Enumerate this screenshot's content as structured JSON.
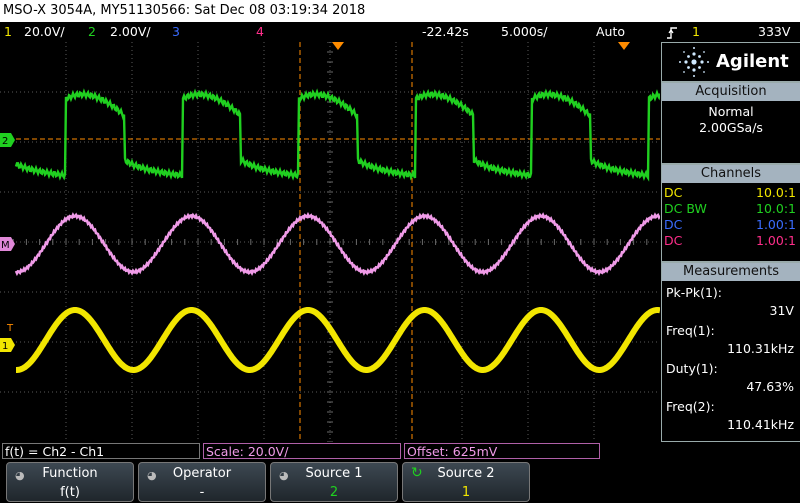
{
  "titlebar": {
    "text": "MSO-X 3054A, MY51130566: Sat Dec 08 03:19:34 2018"
  },
  "channels_bar": {
    "ch1_num": "1",
    "ch1_scale": "20.0V/",
    "ch2_num": "2",
    "ch2_scale": "2.00V/",
    "ch3_num": "3",
    "ch4_num": "4",
    "time_offset": "-22.42s",
    "time_scale": "5.000s/",
    "trigger_mode": "Auto",
    "trigger_icon": "trigger-edge-icon",
    "trigger_source": "1",
    "trigger_level": "333V"
  },
  "logo": {
    "brand": "Agilent",
    "icon": "agilent-spark-icon"
  },
  "acquisition": {
    "title": "Acquisition",
    "mode": "Normal",
    "rate": "2.00GSa/s"
  },
  "channels": {
    "title": "Channels",
    "rows": [
      {
        "coupling": "DC",
        "probe": "10.0:1",
        "color": "#f2e600"
      },
      {
        "coupling": "DC BW",
        "probe": "10.0:1",
        "color": "#20d020"
      },
      {
        "coupling": "DC",
        "probe": "1.00:1",
        "color": "#3a6cff"
      },
      {
        "coupling": "DC",
        "probe": "1.00:1",
        "color": "#ff2e8a"
      }
    ]
  },
  "measurements": {
    "title": "Measurements",
    "items": [
      {
        "label": "Pk-Pk(1):",
        "value": "31V"
      },
      {
        "label": "Freq(1):",
        "value": "110.31kHz"
      },
      {
        "label": "Duty(1):",
        "value": "47.63%"
      },
      {
        "label": "Freq(2):",
        "value": "110.41kHz"
      }
    ]
  },
  "function_bar": {
    "formula": "f(t) = Ch2 - Ch1",
    "scale": "Scale: 20.0V/",
    "offset": "Offset: 625mV"
  },
  "softkeys": [
    {
      "label": "Function",
      "value": "f(t)"
    },
    {
      "label": "Operator",
      "value": "-"
    },
    {
      "label": "Source 1",
      "value": "2"
    },
    {
      "label": "Source 2",
      "value": "1"
    }
  ],
  "markers": {
    "ch2": "2",
    "math": "M",
    "trig": "T",
    "ch1": "1"
  },
  "colors": {
    "ch1": "#f2e600",
    "ch2": "#20d020",
    "ch3": "#3a6cff",
    "ch4": "#ff2e8a",
    "math": "#f09be8",
    "orange": "#ff8c00",
    "magenta": "#e040a0"
  }
}
